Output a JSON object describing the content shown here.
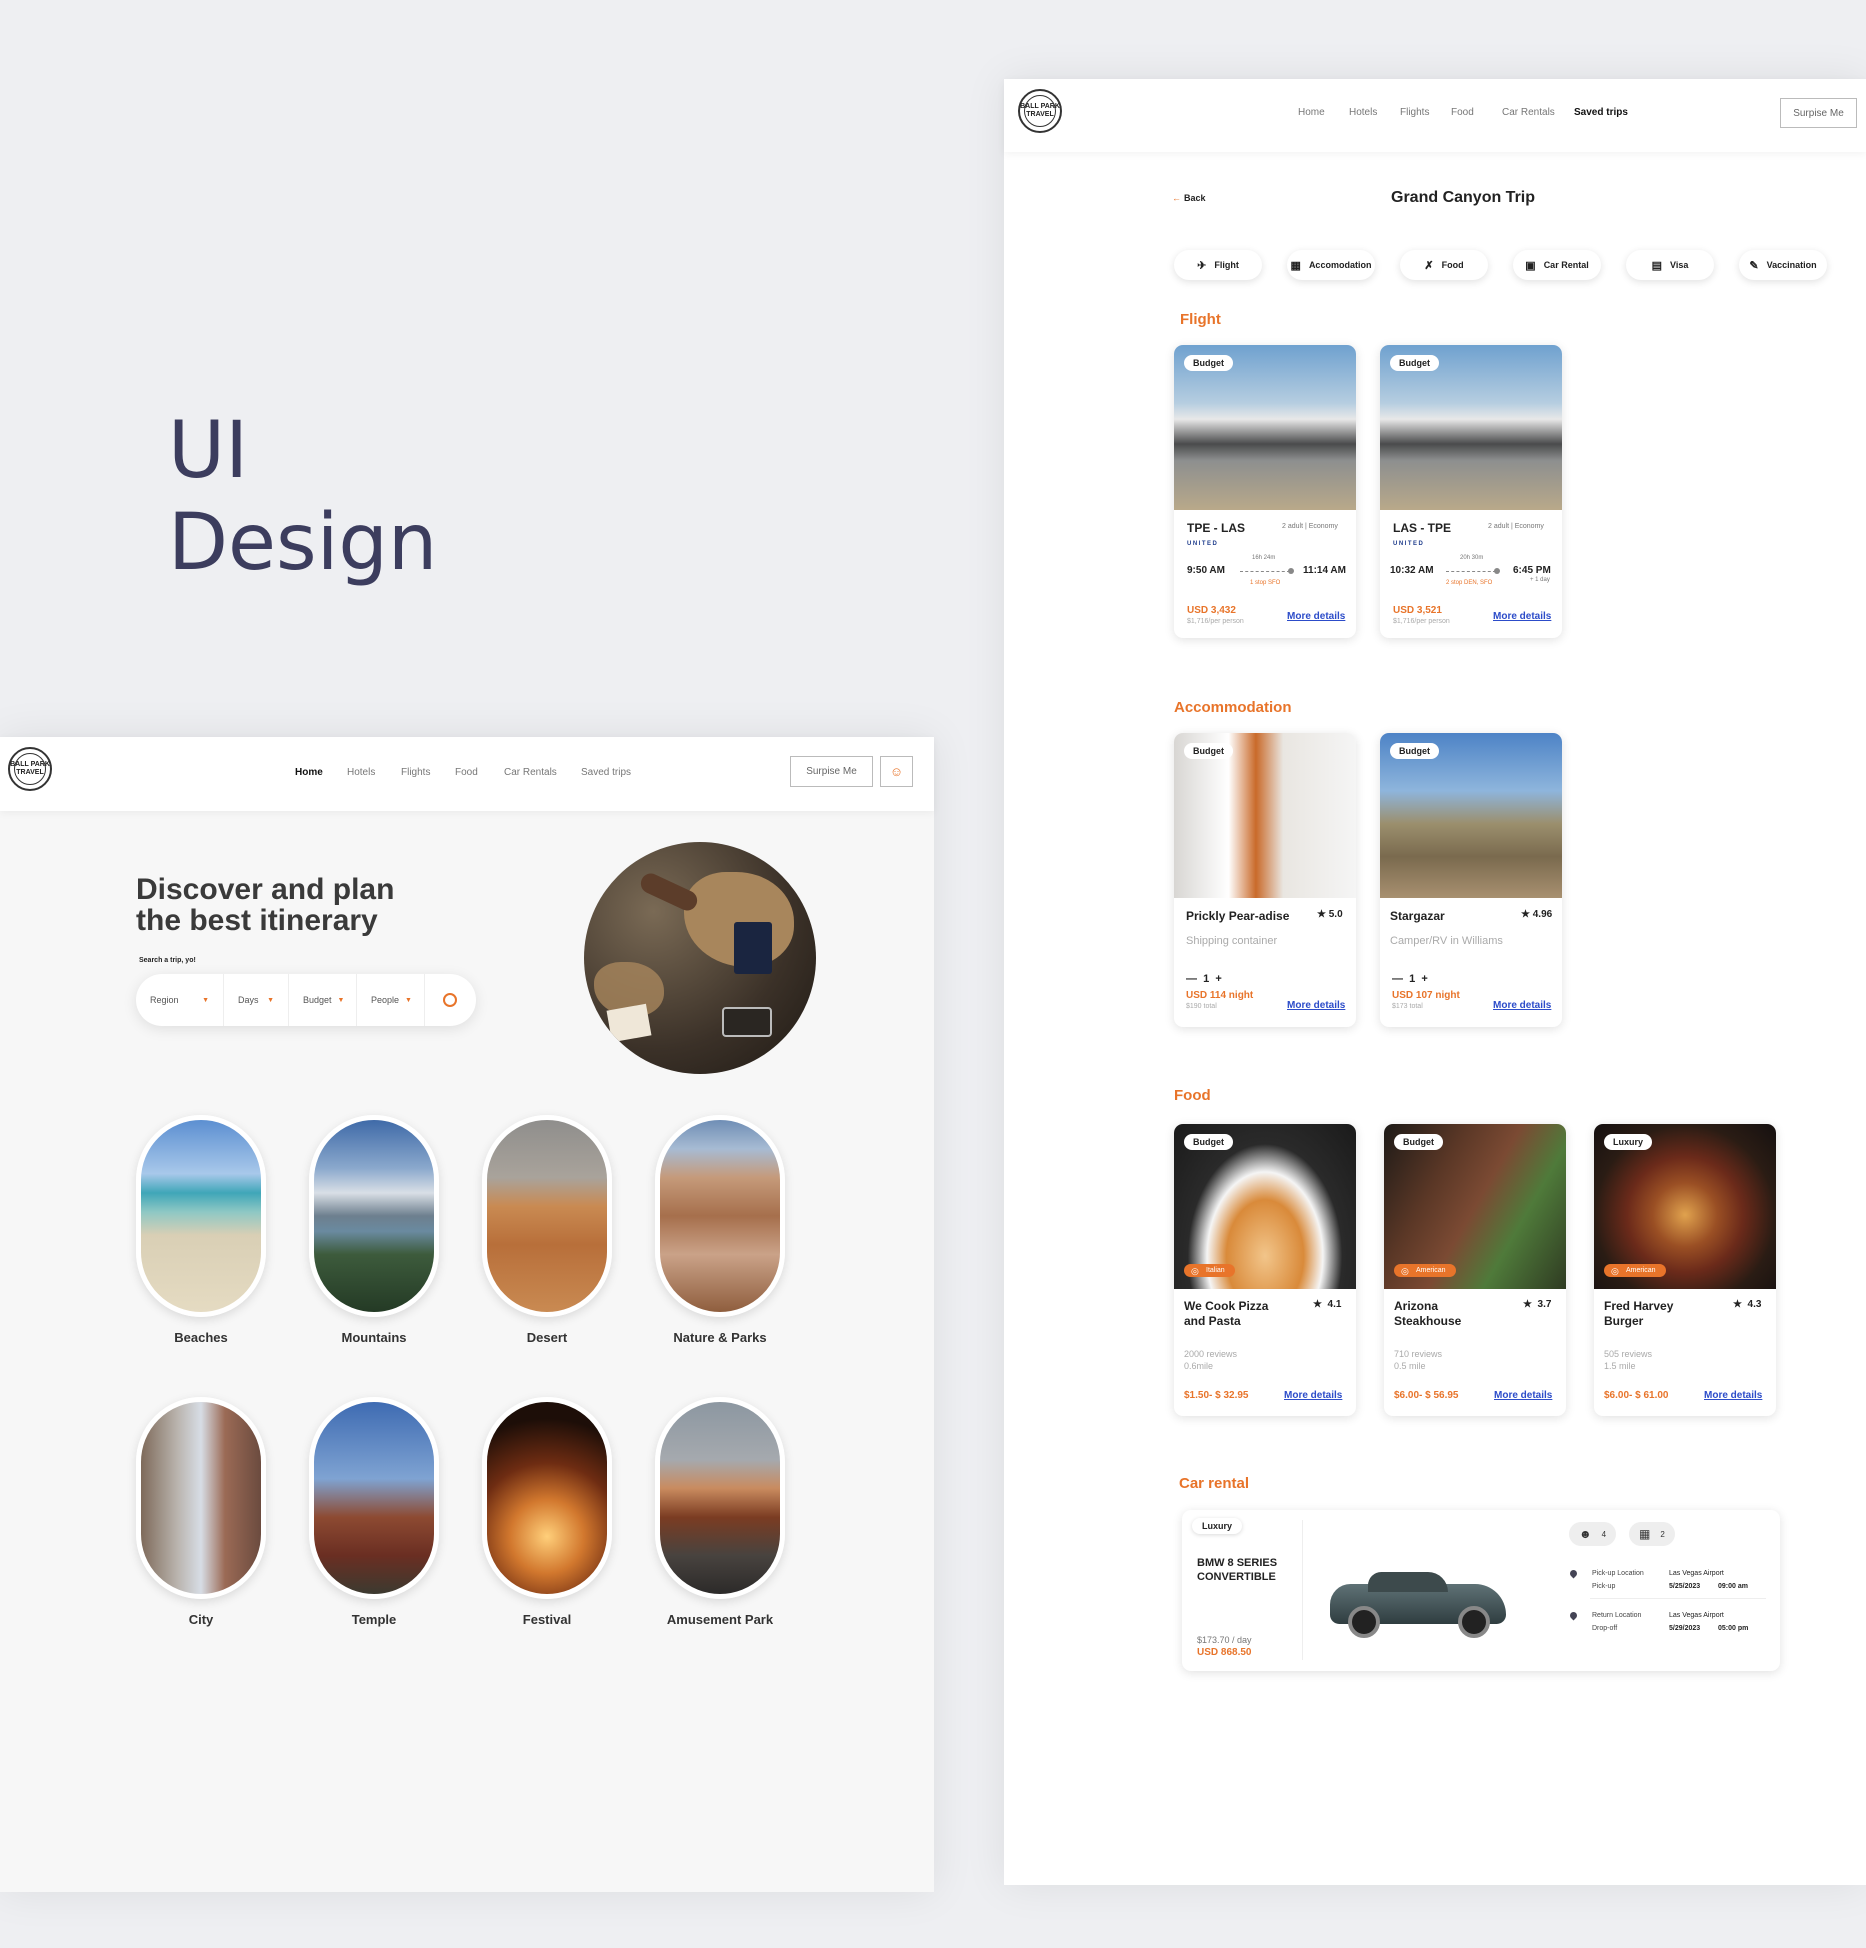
{
  "heading": {
    "line1": "UI",
    "line2": "Design"
  },
  "brand": {
    "logo_text": "BALL PARK TRAVEL",
    "accent_color": "#e8742a",
    "link_color": "#2c4cc9"
  },
  "home": {
    "nav": [
      "Home",
      "Hotels",
      "Flights",
      "Food",
      "Car Rentals",
      "Saved trips"
    ],
    "surprise_label": "Surpise Me",
    "hero_line1": "Discover and plan",
    "hero_line2": "the best itinerary",
    "search_caption": "Search a trip, yo!",
    "search": {
      "region": "Region",
      "days": "Days",
      "budget": "Budget",
      "people": "People"
    },
    "categories": [
      "Beaches",
      "Mountains",
      "Desert",
      "Nature & Parks",
      "City",
      "Temple",
      "Festival",
      "Amusement Park"
    ]
  },
  "trip": {
    "nav": [
      "Home",
      "Hotels",
      "Flights",
      "Food",
      "Car Rentals",
      "Saved trips"
    ],
    "surprise_label": "Surpise Me",
    "back_label": "Back",
    "title": "Grand Canyon Trip",
    "pills": [
      "Flight",
      "Accomodation",
      "Food",
      "Car Rental",
      "Visa",
      "Vaccination"
    ],
    "sections": {
      "flight": "Flight",
      "accommodation": "Accommodation",
      "food": "Food",
      "car": "Car rental"
    },
    "flights": [
      {
        "badge": "Budget",
        "route": "TPE - LAS",
        "class": "2 adult | Economy",
        "airline": "UNITED",
        "depart": "9:50 AM",
        "arrive": "11:14 AM",
        "duration": "16h 24m",
        "stops": "1 stop SFO",
        "next_day": "",
        "price": "USD 3,432",
        "per_person": "$1,716/per person",
        "link": "More details"
      },
      {
        "badge": "Budget",
        "route": "LAS - TPE",
        "class": "2 adult | Economy",
        "airline": "UNITED",
        "depart": "10:32 AM",
        "arrive": "6:45 PM",
        "duration": "20h 30m",
        "stops": "2 stop DEN, SFO",
        "next_day": "+ 1 day",
        "price": "USD 3,521",
        "per_person": "$1,716/per person",
        "link": "More details"
      }
    ],
    "stays": [
      {
        "badge": "Budget",
        "name": "Prickly Pear-adise",
        "rating": "5.0",
        "type": "Shipping container",
        "qty": "1",
        "price": "USD 114 night",
        "total": "$190 total",
        "link": "More details"
      },
      {
        "badge": "Budget",
        "name": "Stargazar",
        "rating": "4.96",
        "type": "Camper/RV in Williams",
        "qty": "1",
        "price": "USD 107 night",
        "total": "$173 total",
        "link": "More details"
      }
    ],
    "foods": [
      {
        "badge": "Budget",
        "cuisine": "Italian",
        "name1": "We Cook Pizza",
        "name2": "and Pasta",
        "rating": "4.1",
        "reviews": "2000  reviews",
        "distance": "0.6mile",
        "price": "$1.50- $ 32.95",
        "link": "More details"
      },
      {
        "badge": "Budget",
        "cuisine": "American",
        "name1": "Arizona",
        "name2": "Steakhouse",
        "rating": "3.7",
        "reviews": "710  reviews",
        "distance": "0.5 mile",
        "price": "$6.00- $ 56.95",
        "link": "More details"
      },
      {
        "badge": "Luxury",
        "cuisine": "American",
        "name1": "Fred Harvey",
        "name2": "Burger",
        "rating": "4.3",
        "reviews": "505  reviews",
        "distance": "1.5 mile",
        "price": "$6.00- $ 61.00",
        "link": "More details"
      }
    ],
    "car": {
      "badge": "Luxury",
      "name1": "BMW 8 SERIES",
      "name2": "CONVERTIBLE",
      "per_day": "$173.70  / day",
      "price": "USD 868.50",
      "seats": "4",
      "bags": "2",
      "pickup_label": "Pick-up Location",
      "pickup_sub": "Pick-up",
      "pickup_place": "Las Vegas Airport",
      "pickup_date": "5/25/2023",
      "pickup_time": "09:00 am",
      "return_label": "Return Location",
      "return_sub": "Drop-off",
      "return_place": "Las Vegas Airport",
      "return_date": "5/29/2023",
      "return_time": "05:00 pm"
    }
  }
}
